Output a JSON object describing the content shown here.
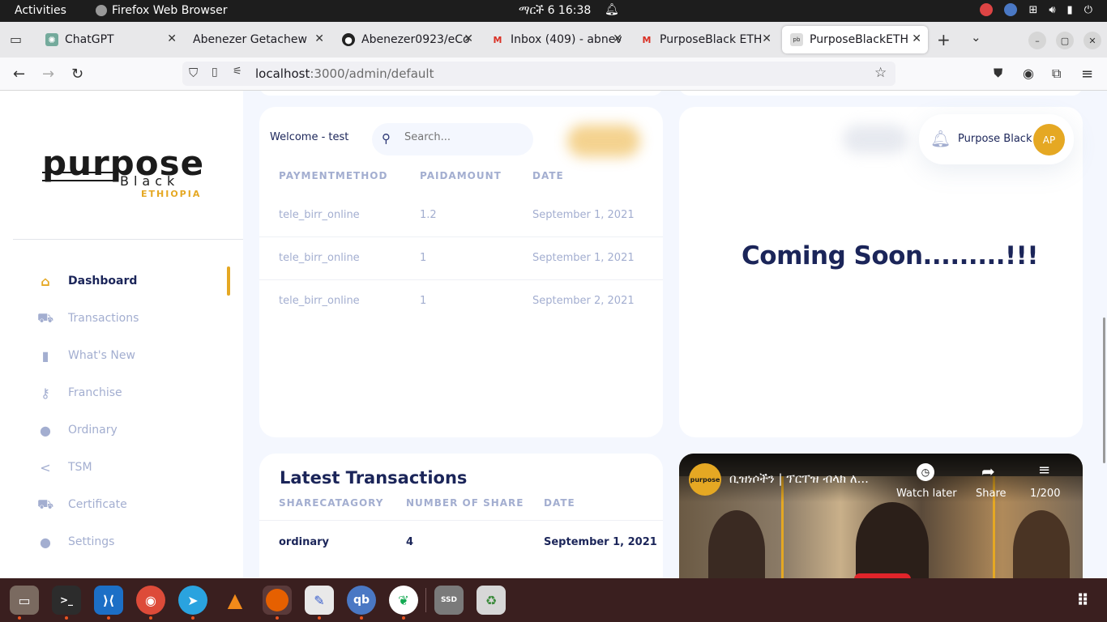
{
  "topbar": {
    "activities": "Activities",
    "app_name": "Firefox Web Browser",
    "clock": "ማርች 6  16:38"
  },
  "tabs": [
    {
      "label": "ChatGPT",
      "icon": "chatgpt-icon"
    },
    {
      "label": "Abenezer Getachew",
      "icon": "none"
    },
    {
      "label": "Abenezer0923/eCo",
      "icon": "github-icon"
    },
    {
      "label": "Inbox (409) - abnev",
      "icon": "gmail-icon"
    },
    {
      "label": "PurposeBlack ETH",
      "icon": "gmail-icon"
    },
    {
      "label": "PurposeBlackETH",
      "icon": "purposeblack-icon"
    }
  ],
  "navbar": {
    "url_host": "localhost",
    "url_path": ":3000/admin/default"
  },
  "header": {
    "welcome": "Welcome - test",
    "search_placeholder": "Search...",
    "user_name": "Purpose Black",
    "avatar_initials": "AP"
  },
  "logo": {
    "word1": "purpose",
    "word2": "Black",
    "word3": "ETHIOPIA"
  },
  "sidebar": {
    "items": [
      {
        "label": "Dashboard",
        "icon": "home-icon",
        "active": true
      },
      {
        "label": "Transactions",
        "icon": "cart-icon"
      },
      {
        "label": "What's New",
        "icon": "bar-chart-icon"
      },
      {
        "label": "Franchise",
        "icon": "key-icon"
      },
      {
        "label": "Ordinary",
        "icon": "person-icon"
      },
      {
        "label": "TSM",
        "icon": "share-icon"
      },
      {
        "label": "Certificate",
        "icon": "cart-icon"
      },
      {
        "label": "Settings",
        "icon": "person-icon"
      }
    ]
  },
  "payments": {
    "columns": [
      "PAYMENTMETHOD",
      "PAIDAMOUNT",
      "DATE"
    ],
    "rows": [
      [
        "tele_birr_online",
        "1.2",
        "September 1, 2021"
      ],
      [
        "tele_birr_online",
        "1",
        "September 1, 2021"
      ],
      [
        "tele_birr_online",
        "1",
        "September 2, 2021"
      ]
    ]
  },
  "coming_soon": "Coming Soon.........!!!",
  "latest": {
    "title": "Latest Transactions",
    "columns": [
      "SHARECATAGORY",
      "NUMBER OF SHARE",
      "DATE"
    ],
    "rows": [
      [
        "ordinary",
        "4",
        "September 1, 2021"
      ]
    ]
  },
  "video": {
    "title": "ቢዝነሶችን | ፕርፐዝ ብላክ ለ...",
    "watch_later": "Watch later",
    "share": "Share",
    "playlist_count": "1/200"
  },
  "colors": {
    "accent": "#e5a823",
    "navy": "#1b2559",
    "muted": "#a3aed0"
  }
}
